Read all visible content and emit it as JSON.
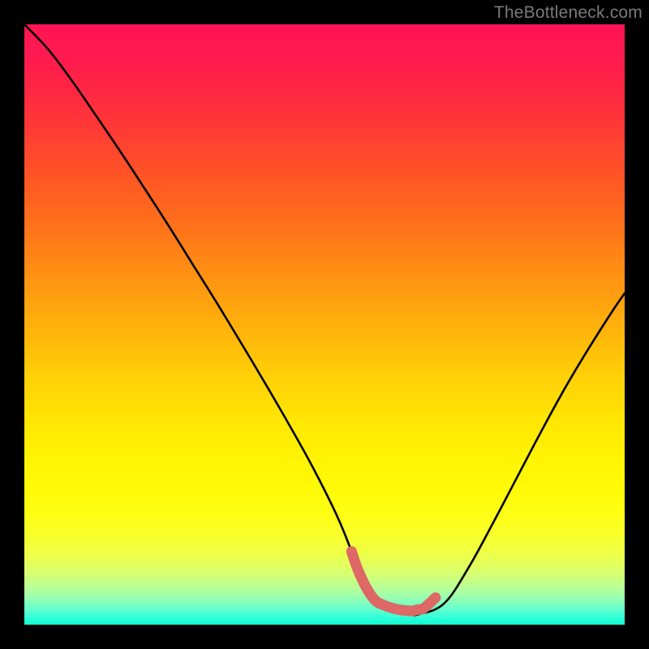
{
  "watermark": "TheBottleneck.com",
  "chart_data": {
    "type": "line",
    "title": "",
    "xlabel": "",
    "ylabel": "",
    "xlim": [
      0,
      1
    ],
    "ylim": [
      0,
      1
    ],
    "series": [
      {
        "name": "bottleneck-curve",
        "x": [
          0.0,
          0.04,
          0.08,
          0.12,
          0.16,
          0.2,
          0.24,
          0.28,
          0.32,
          0.36,
          0.4,
          0.44,
          0.48,
          0.52,
          0.545,
          0.56,
          0.6,
          0.64,
          0.66,
          0.7,
          0.74,
          0.78,
          0.82,
          0.86,
          0.9,
          0.94,
          0.98,
          1.0
        ],
        "y": [
          1.0,
          0.958,
          0.905,
          0.847,
          0.788,
          0.727,
          0.665,
          0.601,
          0.537,
          0.471,
          0.404,
          0.335,
          0.263,
          0.183,
          0.122,
          0.075,
          0.032,
          0.018,
          0.018,
          0.036,
          0.095,
          0.168,
          0.244,
          0.32,
          0.393,
          0.46,
          0.523,
          0.552
        ]
      },
      {
        "name": "sweet-spot-marker",
        "x": [
          0.545,
          0.555,
          0.57,
          0.585,
          0.6,
          0.615,
          0.63,
          0.645,
          0.655,
          0.665,
          0.685
        ],
        "y": [
          0.122,
          0.093,
          0.061,
          0.04,
          0.032,
          0.027,
          0.024,
          0.023,
          0.025,
          0.027,
          0.045
        ]
      }
    ],
    "gradient_stops": [
      {
        "t": 0.0,
        "color": "#ff1455"
      },
      {
        "t": 0.06,
        "color": "#ff1b4e"
      },
      {
        "t": 0.12,
        "color": "#ff2a41"
      },
      {
        "t": 0.18,
        "color": "#ff3c34"
      },
      {
        "t": 0.24,
        "color": "#ff5028"
      },
      {
        "t": 0.3,
        "color": "#ff651f"
      },
      {
        "t": 0.36,
        "color": "#ff7b18"
      },
      {
        "t": 0.42,
        "color": "#ff9212"
      },
      {
        "t": 0.48,
        "color": "#ffa90d"
      },
      {
        "t": 0.54,
        "color": "#ffbf09"
      },
      {
        "t": 0.6,
        "color": "#ffd406"
      },
      {
        "t": 0.66,
        "color": "#ffe604"
      },
      {
        "t": 0.72,
        "color": "#fff303"
      },
      {
        "t": 0.78,
        "color": "#fffb08"
      },
      {
        "t": 0.82,
        "color": "#feff17"
      },
      {
        "t": 0.855,
        "color": "#f7ff2e"
      },
      {
        "t": 0.885,
        "color": "#ecff4b"
      },
      {
        "t": 0.91,
        "color": "#dbff6b"
      },
      {
        "t": 0.93,
        "color": "#c4ff8a"
      },
      {
        "t": 0.948,
        "color": "#a7ffa6"
      },
      {
        "t": 0.963,
        "color": "#84ffbd"
      },
      {
        "t": 0.975,
        "color": "#5fffce"
      },
      {
        "t": 0.985,
        "color": "#3cffd7"
      },
      {
        "t": 0.993,
        "color": "#20ffd9"
      },
      {
        "t": 1.0,
        "color": "#0fffd0"
      }
    ],
    "accent_color": "#dd6866",
    "curve_color": "#000000"
  }
}
